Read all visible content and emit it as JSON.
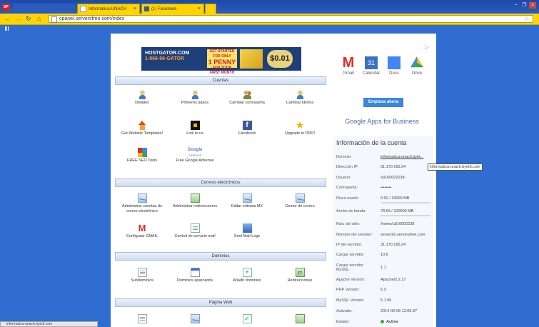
{
  "browser": {
    "window_logo": "SP",
    "tabs": [
      {
        "label": "",
        "icon": "page-icon"
      },
      {
        "label": "Informatica-UNACH",
        "icon": "page-icon"
      },
      {
        "label": "(1) Facebook",
        "icon": "facebook-icon"
      },
      {
        "label": "",
        "icon": "new-tab-icon"
      }
    ],
    "tab_close": "×",
    "url": "cpanel.serversfree.com/index",
    "window_buttons": {
      "minimize": "−",
      "maximize": "❐",
      "close": "×"
    }
  },
  "banner": {
    "brand": "HOSTGATOR.COM",
    "phone": "1-866-96-GATOR",
    "promo_line1": "GET STARTED FOR ONLY",
    "promo_big": "1 PENNY",
    "promo_line2": "FOR YOUR FIRST MONTH",
    "price": "$0.01"
  },
  "sections": {
    "cuentas": "Cuentas",
    "correos": "Correos electrónicos",
    "dominios": "Dominios",
    "pagina_web": "Página Web"
  },
  "cuentas_items": [
    {
      "label": "Detalles",
      "icon": "person-icon"
    },
    {
      "label": "Primeros pasos",
      "icon": "person-icon"
    },
    {
      "label": "Cambiar contraseña",
      "icon": "people-icon"
    },
    {
      "label": "Cambiar idioma",
      "icon": "person-icon"
    },
    {
      "label": "Get Website Templates!",
      "icon": "house-icon"
    },
    {
      "label": "Link to us",
      "icon": "link-icon"
    },
    {
      "label": "Facebook",
      "icon": "facebook-icon"
    },
    {
      "label": "Upgrade to PRO!",
      "icon": "star-icon"
    },
    {
      "label": "FREE SEO Tools",
      "icon": "seo-icon"
    },
    {
      "label": "Free Google Adsense",
      "icon": "google-icon",
      "logo_text": "Google",
      "logo_sub": "AdSense"
    }
  ],
  "correos_items": [
    {
      "label": "Administrar cuentas de correo electrónico",
      "icon": "mail-icon"
    },
    {
      "label": "Administrar redirecciones",
      "icon": "mail-forward-icon"
    },
    {
      "label": "Editar entrada MX",
      "icon": "mx-icon"
    },
    {
      "label": "Gestor de correo",
      "icon": "mail-manager-icon"
    },
    {
      "label": "Configurar GMAIL",
      "icon": "gmail-icon",
      "glyph": "M"
    },
    {
      "label": "Control de servicio mail",
      "icon": "mail-control-icon"
    },
    {
      "label": "Sent Mail Logs",
      "icon": "mail-logs-icon"
    }
  ],
  "dominios_items": [
    {
      "label": "Subdominios",
      "icon": "subdomain-icon"
    },
    {
      "label": "Dominios aparcados",
      "icon": "parked-domain-icon"
    },
    {
      "label": "Añadir dominios",
      "icon": "add-domain-icon"
    },
    {
      "label": "Redirecciones",
      "icon": "redirect-icon",
      "glyph": "⇄"
    }
  ],
  "pagina_web_items": [
    {
      "icon": "web-icon-1"
    },
    {
      "icon": "web-icon-2"
    },
    {
      "icon": "web-icon-3",
      "glyph": "✓"
    },
    {
      "icon": "web-icon-4"
    }
  ],
  "ad": {
    "close_icon": "ad-choices-icon",
    "apps": [
      {
        "label": "Gmail",
        "icon": "gmail-icon",
        "glyph": "M"
      },
      {
        "label": "Calendar",
        "icon": "calendar-icon",
        "glyph": "31"
      },
      {
        "label": "Docs",
        "icon": "docs-icon"
      },
      {
        "label": "Drive",
        "icon": "drive-icon"
      }
    ],
    "cta": "Empieza ahora",
    "tagline": "Google Apps for Business"
  },
  "account": {
    "title": "Información de la cuenta",
    "rows": [
      {
        "k": "Dominio:",
        "v": "informatica-unach.byet..."
      },
      {
        "k": "Dirección IP:",
        "v": "31.170.165.24"
      },
      {
        "k": "Usuario:",
        "v": "a3160002238"
      },
      {
        "k": "Contraseña:",
        "v": "••••••••"
      },
      {
        "k": "Disco usado:",
        "v": "0.02 / 10000 MB",
        "bar": 0.0
      },
      {
        "k": "Ancho de banda:",
        "v": "78.69 / 100000 MB",
        "bar": 0.001
      },
      {
        "k": "Raíz del sitio:",
        "v": "/home/u316002238"
      },
      {
        "k": "Nombre del servidor:",
        "v": "server20.serversfree.com"
      },
      {
        "k": "IP del servidor:",
        "v": "31.170.165.24"
      },
      {
        "k": "Cargar servidor:",
        "v": "10.6"
      },
      {
        "k": "Cargar servidor MySQL:",
        "v": "1.1"
      },
      {
        "k": "Apache Versión:",
        "v": "Apache/2.2.17"
      },
      {
        "k": "PHP Versión:",
        "v": "5.3"
      },
      {
        "k": "MySQL Versión:",
        "v": "5.1.56"
      },
      {
        "k": "Activado:",
        "v": "2014-06-05 12:05:37"
      },
      {
        "k": "Estado:",
        "v": "Activo"
      }
    ],
    "tooltip": "informatica-unach.byet3.com"
  },
  "status_bar": "informatica-unach.byet3.com"
}
